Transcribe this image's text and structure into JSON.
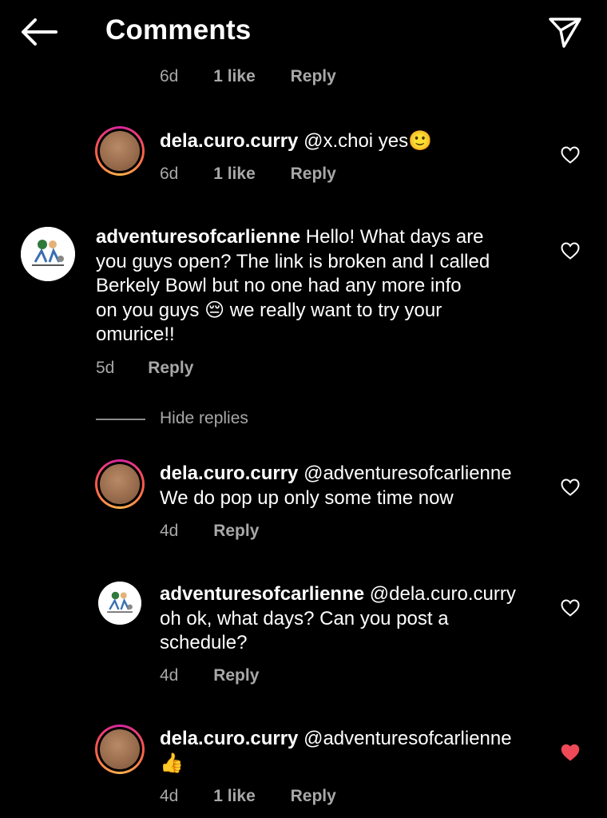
{
  "header": {
    "title": "Comments",
    "back_icon": "arrow-left-icon",
    "send_icon": "paper-plane-icon"
  },
  "colors": {
    "background": "#000000",
    "secondary_text": "#a8a8a8",
    "liked_heart": "#ed4956"
  },
  "top_partial": {
    "time": "6d",
    "likes": "1 like",
    "reply": "Reply"
  },
  "comments": [
    {
      "user": "dela.curo.curry",
      "text": "@x.choi yes🙂",
      "time": "6d",
      "likes": "1 like",
      "reply": "Reply",
      "liked": false
    },
    {
      "user": "adventuresofcarlienne",
      "line1": "Hello! What days are",
      "line2": "you guys open? The link is broken and I called",
      "line3": "Berkely Bowl but no one had any more info",
      "line4": "on you guys 😔 we really want to try your",
      "line5": "omurice!!",
      "time": "5d",
      "reply": "Reply",
      "liked": false
    },
    {
      "user": "dela.curo.curry",
      "mention": "@adventuresofcarlienne",
      "line2": "We do pop up only some time now",
      "time": "4d",
      "reply": "Reply",
      "liked": false
    },
    {
      "user": "adventuresofcarlienne",
      "mention": "@dela.curo.curry",
      "line2": "oh ok, what days? Can you post a",
      "line3": "schedule?",
      "time": "4d",
      "reply": "Reply",
      "liked": false
    },
    {
      "user": "dela.curo.curry",
      "mention": "@adventuresofcarlienne",
      "line2": "👍",
      "time": "4d",
      "likes": "1 like",
      "reply": "Reply",
      "liked": true
    }
  ],
  "hide_replies": "Hide replies"
}
